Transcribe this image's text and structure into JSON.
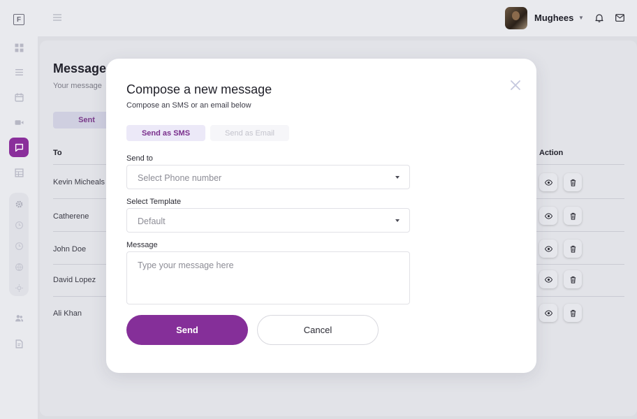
{
  "app": {
    "logo_letter": "F"
  },
  "topbar": {
    "username": "Mughees"
  },
  "page": {
    "title": "Messages",
    "subtitle": "Your message",
    "tab_sent": "Sent",
    "columns": {
      "to": "To",
      "action": "Action"
    },
    "rows": [
      {
        "name": "Kevin Micheals"
      },
      {
        "name": "Catherene"
      },
      {
        "name": "John Doe"
      },
      {
        "name": "David Lopez"
      },
      {
        "name": "Ali Khan"
      }
    ]
  },
  "modal": {
    "title": "Compose a new message",
    "subtitle": "Compose an SMS or an email below",
    "toggle_sms": "Send as SMS",
    "toggle_email": "Send as Email",
    "send_to_label": "Send to",
    "send_to_placeholder": "Select Phone number",
    "template_label": "Select Template",
    "template_value": "Default",
    "message_label": "Message",
    "message_placeholder": "Type your message here",
    "send_button": "Send",
    "cancel_button": "Cancel"
  },
  "colors": {
    "accent": "#852f99",
    "sidebar_active": "#8a2f9b",
    "toggle_active_bg": "#ece9f8"
  },
  "icons": {
    "sidebar": [
      "dashboard-icon",
      "list-icon",
      "calendar-icon",
      "video-icon",
      "chat-icon",
      "table-icon",
      "gear-icon",
      "clock-icon",
      "clock-icon",
      "globe-icon",
      "sun-icon",
      "users-icon",
      "document-icon"
    ],
    "row_actions": [
      "eye-icon",
      "trash-icon"
    ]
  }
}
